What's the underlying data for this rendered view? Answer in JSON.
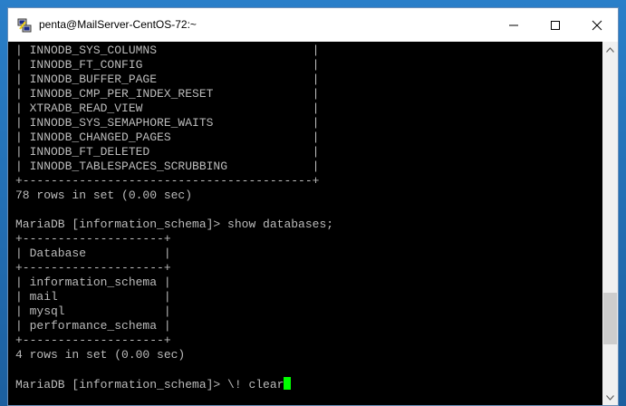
{
  "window": {
    "title": "penta@MailServer-CentOS-72:~",
    "app_icon": "putty-icon",
    "controls": {
      "minimize_icon": "minimize-icon",
      "maximize_icon": "maximize-icon",
      "close_icon": "close-icon"
    }
  },
  "terminal": {
    "lines": [
      "| INNODB_SYS_COLUMNS                      |",
      "| INNODB_FT_CONFIG                        |",
      "| INNODB_BUFFER_PAGE                      |",
      "| INNODB_CMP_PER_INDEX_RESET              |",
      "| XTRADB_READ_VIEW                        |",
      "| INNODB_SYS_SEMAPHORE_WAITS              |",
      "| INNODB_CHANGED_PAGES                    |",
      "| INNODB_FT_DELETED                       |",
      "| INNODB_TABLESPACES_SCRUBBING            |",
      "+-----------------------------------------+",
      "78 rows in set (0.00 sec)",
      "",
      "MariaDB [information_schema]> show databases;",
      "+--------------------+",
      "| Database           |",
      "+--------------------+",
      "| information_schema |",
      "| mail               |",
      "| mysql              |",
      "| performance_schema |",
      "+--------------------+",
      "4 rows in set (0.00 sec)",
      "",
      "MariaDB [information_schema]> \\! clear"
    ],
    "cursor_color": "#00ff00",
    "text_color": "#bbbbbb",
    "background_color": "#000000"
  },
  "scrollbar": {
    "position_fraction": 0.84
  }
}
